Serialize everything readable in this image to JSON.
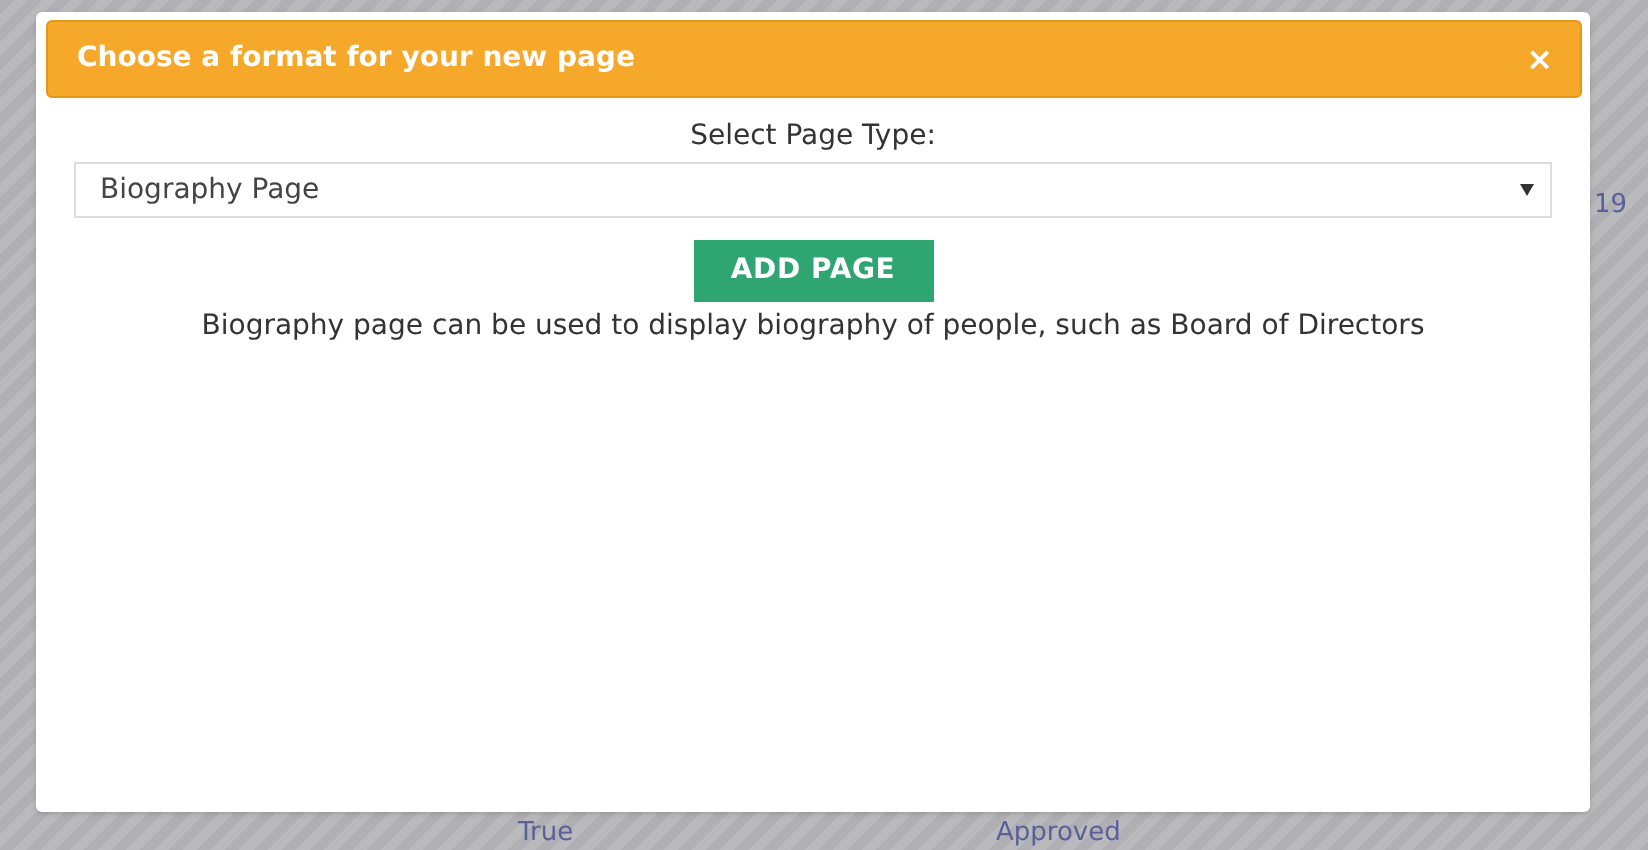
{
  "background": {
    "cell_texts": [
      {
        "text": "19"
      },
      {
        "text": "True"
      },
      {
        "text": "Approved"
      }
    ]
  },
  "dialog": {
    "title": "Choose a format for your new page",
    "close": "×",
    "select_label": "Select Page Type:",
    "select_value": "Biography Page",
    "button": "ADD PAGE",
    "description": "Biography page can be used to display biography of people, such as Board of Directors"
  }
}
